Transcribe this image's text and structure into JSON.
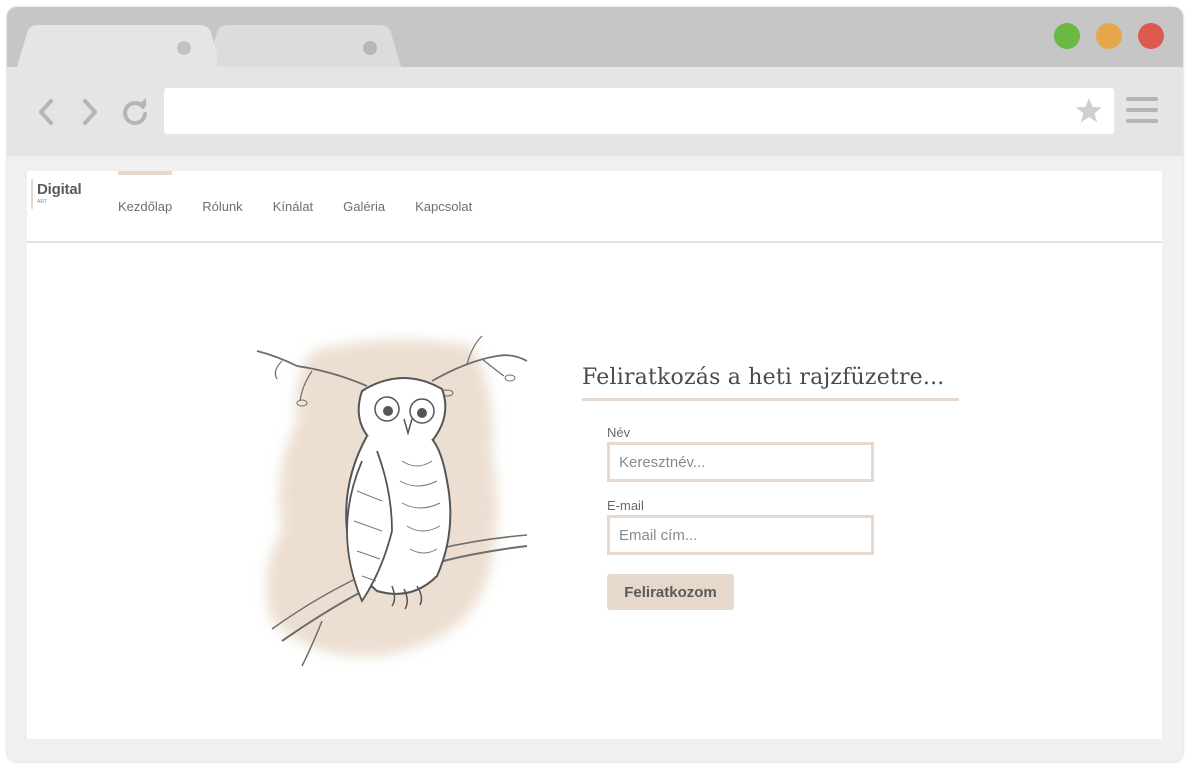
{
  "browser": {
    "tabs": [
      {
        "label": ""
      },
      {
        "label": ""
      }
    ],
    "address": "",
    "window_controls": [
      "green",
      "yellow",
      "red"
    ],
    "icons": {
      "back": "chevron-left-icon",
      "forward": "chevron-right-icon",
      "reload": "reload-icon",
      "bookmark": "star-icon",
      "menu": "hamburger-menu-icon"
    }
  },
  "site": {
    "logo": {
      "main": "Digital",
      "sub": "ART"
    },
    "nav": [
      {
        "label": "Kezdőlap",
        "active": true
      },
      {
        "label": "Rólunk",
        "active": false
      },
      {
        "label": "Kínálat",
        "active": false
      },
      {
        "label": "Galéria",
        "active": false
      },
      {
        "label": "Kapcsolat",
        "active": false
      }
    ]
  },
  "signup": {
    "title": "Feliratkozás a heti rajzfüzetre...",
    "name_label": "Név",
    "name_placeholder": "Keresztnév...",
    "email_label": "E-mail",
    "email_placeholder": "Email cím...",
    "submit_label": "Feliratkozom"
  },
  "colors": {
    "accent": "#e6d8ca",
    "text": "#4a4a4a",
    "frame": "#c6c6c6",
    "toolbar": "#e5e5e5"
  }
}
